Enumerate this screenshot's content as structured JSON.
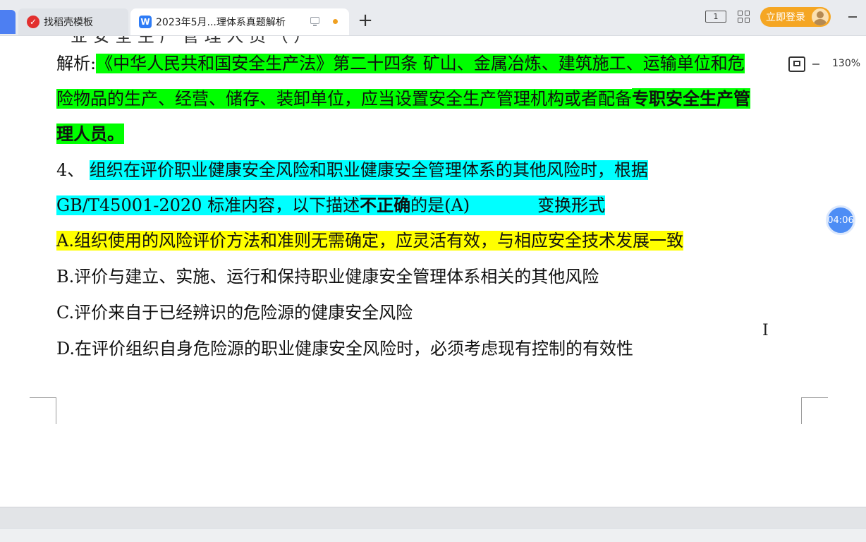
{
  "tabs": [
    {
      "label": "找稻壳模板",
      "icon": "docer-icon",
      "active": false
    },
    {
      "label": "2023年5月...理体系真题解析",
      "icon": "wps-writer-icon",
      "active": true
    }
  ],
  "toolbar": {
    "login_label": "立即登录",
    "zoom": "130%",
    "reader_icon_text": "1"
  },
  "document": {
    "top_fragment": "业 安 全 生 产 管 理 人 员 （ ）",
    "analysis": {
      "prefix": "解析:",
      "line1": "《中华人民共和国安全生产法》第二十四条 矿山、金属冶炼、建筑施工、运输单位和危",
      "line2_normal": "险物品的生产、经营、储存、装卸单位，应当设置安全生产管理机构或者配备",
      "line2_bold": "专职安全生产管",
      "line3_bold": "理人员。"
    },
    "question": {
      "number": "4、",
      "line1": "组织在评价职业健康安全风险和职业健康安全管理体系的其他风险时，根据",
      "line2_a": "GB/T45001-2020 标准内容，以下描述",
      "line2_bold": "不正确",
      "line2_b": "的是(A)",
      "note": "变换形式"
    },
    "options": [
      "A.组织使用的风险评价方法和准则无需确定，应灵活有效，与相应安全技术发展一致",
      "B.评价与建立、实施、运行和保持职业健康安全管理体系相关的其他风险",
      "C.评价来自于已经辨识的危险源的健康安全风险",
      "D.在评价组织自身危险源的职业健康安全风险时，必须考虑现有控制的有效性"
    ]
  },
  "timer": "04:06",
  "colors": {
    "highlight_green": "#00ff00",
    "highlight_cyan": "#00ffff",
    "highlight_yellow": "#ffff00",
    "login_button": "#f5a623",
    "timer_badge": "#4d8df5"
  }
}
